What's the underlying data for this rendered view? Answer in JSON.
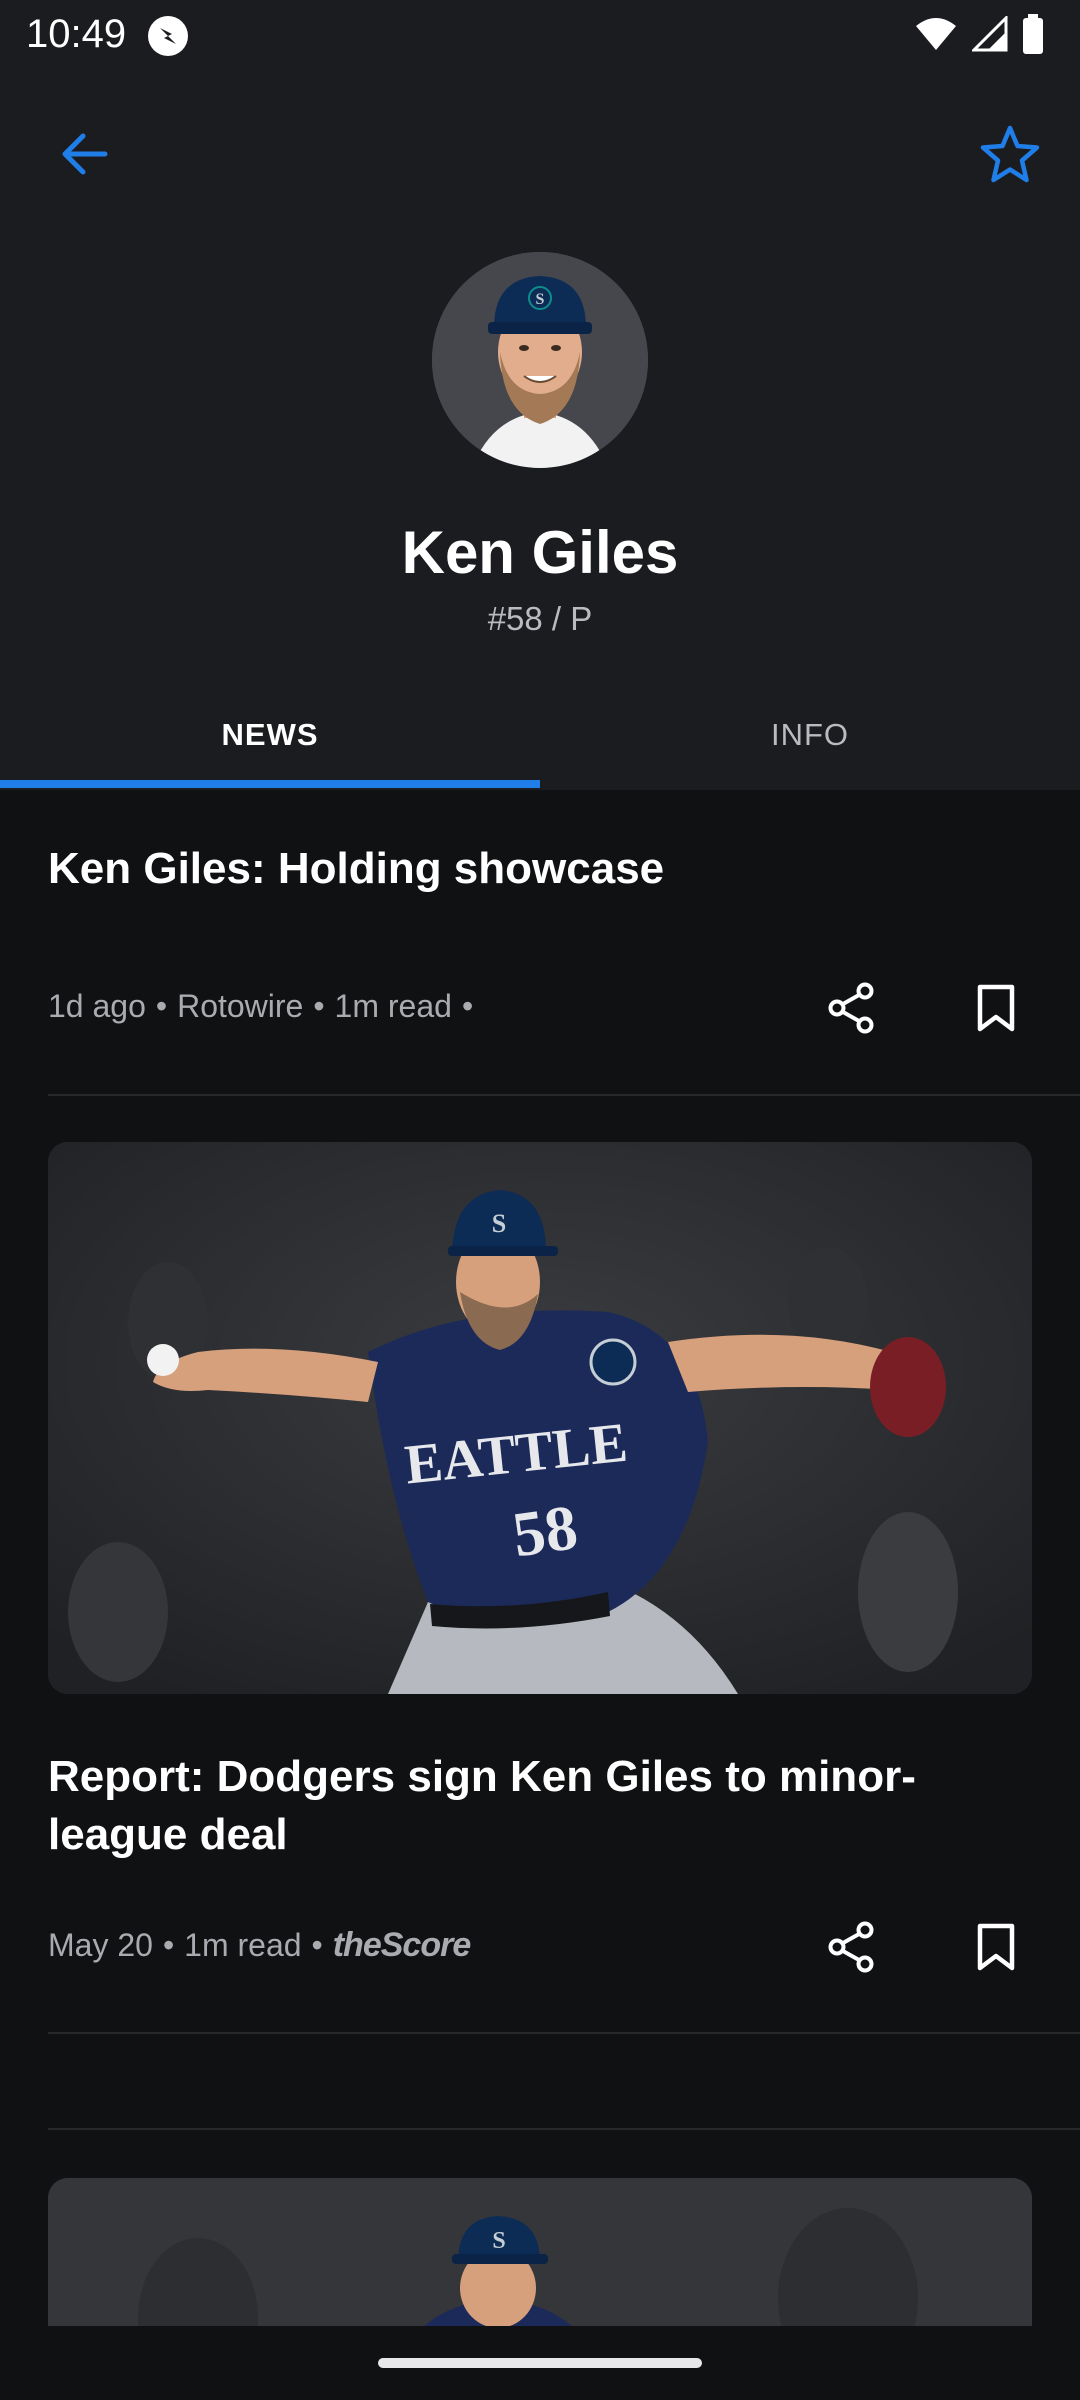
{
  "status_bar": {
    "time": "10:49"
  },
  "player": {
    "name": "Ken Giles",
    "meta": "#58 / P"
  },
  "tabs": [
    {
      "label": "NEWS"
    },
    {
      "label": "INFO"
    }
  ],
  "articles": [
    {
      "title": "Ken Giles: Holding showcase",
      "time": "1d ago",
      "source": "Rotowire",
      "read": "1m read"
    },
    {
      "title": "Report: Dodgers sign Ken Giles to minor-league deal",
      "time": "May 20",
      "read": "1m read",
      "source_logo": "theScore",
      "image_caption_jersey": "SEATTLE 58"
    }
  ],
  "colors": {
    "accent": "#1f7ee8",
    "background": "#1b1c1f",
    "content_background": "#101113"
  },
  "icons": [
    "back-arrow-icon",
    "star-outline-icon",
    "share-icon",
    "bookmark-icon",
    "wifi-icon",
    "signal-icon",
    "battery-icon"
  ]
}
